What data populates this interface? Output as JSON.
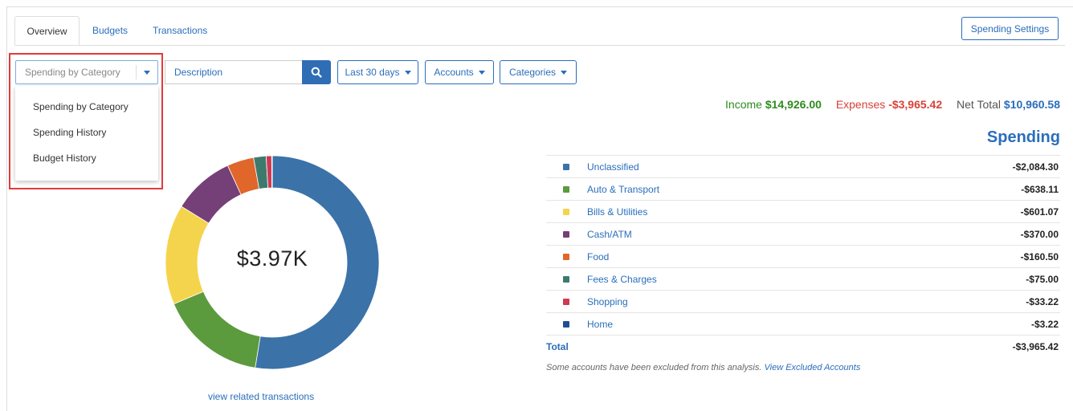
{
  "tabs": [
    {
      "label": "Overview"
    },
    {
      "label": "Budgets"
    },
    {
      "label": "Transactions"
    }
  ],
  "spending_settings_label": "Spending Settings",
  "view_select": {
    "value": "Spending by Category",
    "options": [
      "Spending by Category",
      "Spending History",
      "Budget History"
    ]
  },
  "search": {
    "placeholder": "Description",
    "icon": "search-icon"
  },
  "filters": {
    "date": "Last 30 days",
    "accounts": "Accounts",
    "categories": "Categories"
  },
  "summary": {
    "income_label": "Income",
    "income_value": "$14,926.00",
    "expenses_label": "Expenses",
    "expenses_value": "-$3,965.42",
    "net_label": "Net Total",
    "net_value": "$10,960.58",
    "colors": {
      "income": "#2e8b1f",
      "expenses": "#d9413a",
      "net_label": "#555555",
      "net_value": "#2a6ebb"
    }
  },
  "spending_title": "Spending",
  "categories": [
    {
      "name": "Unclassified",
      "amount": "-$2,084.30",
      "value": 2084.3,
      "color": "#3b72a8"
    },
    {
      "name": "Auto & Transport",
      "amount": "-$638.11",
      "value": 638.11,
      "color": "#5c9a3e"
    },
    {
      "name": "Bills & Utilities",
      "amount": "-$601.07",
      "value": 601.07,
      "color": "#f5d44d"
    },
    {
      "name": "Cash/ATM",
      "amount": "-$370.00",
      "value": 370.0,
      "color": "#753f78"
    },
    {
      "name": "Food",
      "amount": "-$160.50",
      "value": 160.5,
      "color": "#e0662a"
    },
    {
      "name": "Fees & Charges",
      "amount": "-$75.00",
      "value": 75.0,
      "color": "#3d7a6e"
    },
    {
      "name": "Shopping",
      "amount": "-$33.22",
      "value": 33.22,
      "color": "#cf3a52"
    },
    {
      "name": "Home",
      "amount": "-$3.22",
      "value": 3.22,
      "color": "#1f4e96"
    }
  ],
  "total": {
    "label": "Total",
    "amount": "-$3,965.42"
  },
  "donut_center": "$3.97K",
  "exclusion_note": "Some accounts have been excluded from this analysis.",
  "exclusion_link": "View Excluded Accounts",
  "related_link": "view related transactions"
}
